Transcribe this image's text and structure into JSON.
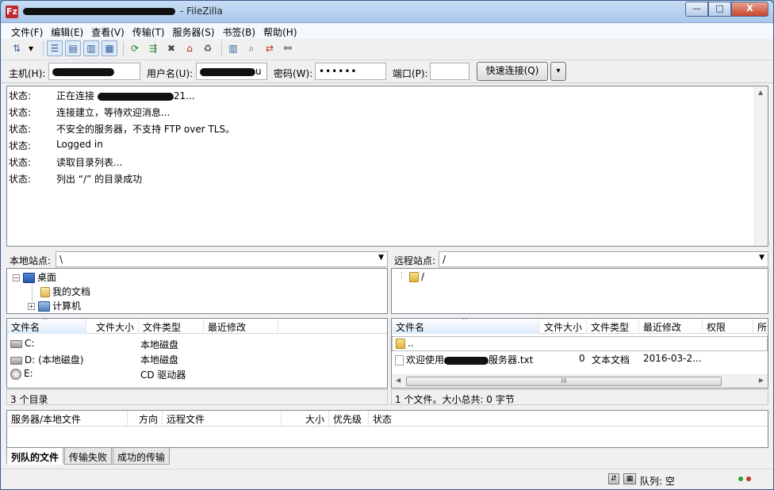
{
  "window": {
    "app_icon": "Fz",
    "title_suffix": "- FileZilla",
    "controls": {
      "minimize": "—",
      "maximize": "□",
      "close": "X"
    }
  },
  "menu": [
    "文件(F)",
    "编辑(E)",
    "查看(V)",
    "传输(T)",
    "服务器(S)",
    "书签(B)",
    "帮助(H)"
  ],
  "toolbar": {
    "icons": [
      "site-manager-icon",
      "dropdown-arrow-icon",
      "toggle-log-icon",
      "toggle-local-tree-icon",
      "toggle-remote-tree-icon",
      "toggle-queue-icon",
      "refresh-icon",
      "process-queue-icon",
      "cancel-icon",
      "disconnect-icon",
      "reconnect-icon",
      "filter-icon",
      "compare-icon",
      "sync-browse-icon",
      "search-icon"
    ],
    "glyphs": [
      "⇅",
      "▾",
      "☰",
      "▤",
      "▥",
      "▦",
      "⟳",
      "⇶",
      "✖",
      "⌂",
      "♻",
      "▥",
      "⌕",
      "⇄",
      "⚯"
    ]
  },
  "quickconnect": {
    "host_label": "主机(H):",
    "host_value_visible": "",
    "user_label": "用户名(U):",
    "user_value_visible": "u",
    "password_label": "密码(W):",
    "password_value": "••••••",
    "port_label": "端口(P):",
    "port_value": "",
    "connect_button": "快速连接(Q)",
    "dropdown": "▾"
  },
  "log": [
    {
      "label": "状态:",
      "message": "正在连接",
      "suffix": "21..."
    },
    {
      "label": "状态:",
      "message": "连接建立，等待欢迎消息...",
      "suffix": ""
    },
    {
      "label": "状态:",
      "message": "不安全的服务器，不支持 FTP over TLS。",
      "suffix": ""
    },
    {
      "label": "状态:",
      "message": "Logged in",
      "suffix": ""
    },
    {
      "label": "状态:",
      "message": "读取目录列表...",
      "suffix": ""
    },
    {
      "label": "状态:",
      "message": "列出 “/” 的目录成功",
      "suffix": ""
    }
  ],
  "local": {
    "site_label": "本地站点:",
    "path": "\\",
    "tree": [
      {
        "label": "桌面",
        "icon": "desktop-icon",
        "expander": "−"
      },
      {
        "label": "我的文档",
        "icon": "documents-folder-icon",
        "expander": ""
      },
      {
        "label": "计算机",
        "icon": "computer-icon",
        "expander": "+"
      }
    ],
    "columns": [
      "文件名",
      "文件大小",
      "文件类型",
      "最近修改"
    ],
    "files": [
      {
        "name": "C:",
        "size": "",
        "type": "本地磁盘",
        "modified": "",
        "icon": "drive-icon"
      },
      {
        "name": "D: (本地磁盘)",
        "size": "",
        "type": "本地磁盘",
        "modified": "",
        "icon": "drive-icon"
      },
      {
        "name": "E:",
        "size": "",
        "type": "CD 驱动器",
        "modified": "",
        "icon": "cd-drive-icon"
      }
    ],
    "status": "3 个目录"
  },
  "remote": {
    "site_label": "远程站点:",
    "path": "/",
    "tree": [
      {
        "label": "/",
        "icon": "folder-icon"
      }
    ],
    "columns": [
      "文件名",
      "文件大小",
      "文件类型",
      "最近修改",
      "权限",
      "所"
    ],
    "files": [
      {
        "name": "..",
        "size": "",
        "type": "",
        "modified": "",
        "icon": "folder-icon"
      },
      {
        "name_prefix": "欢迎使用",
        "name_suffix": "服务器.txt",
        "size": "0",
        "type": "文本文档",
        "modified": "2016-03-2...",
        "icon": "text-file-icon"
      }
    ],
    "status": "1 个文件。大小总共: 0 字节",
    "hscroll_thumb": "III"
  },
  "queue": {
    "columns": [
      "服务器/本地文件",
      "方向",
      "远程文件",
      "大小",
      "优先级",
      "状态"
    ]
  },
  "tabs": [
    "列队的文件",
    "传输失败",
    "成功的传输"
  ],
  "statusbar": {
    "queue_label": "队列: 空"
  }
}
